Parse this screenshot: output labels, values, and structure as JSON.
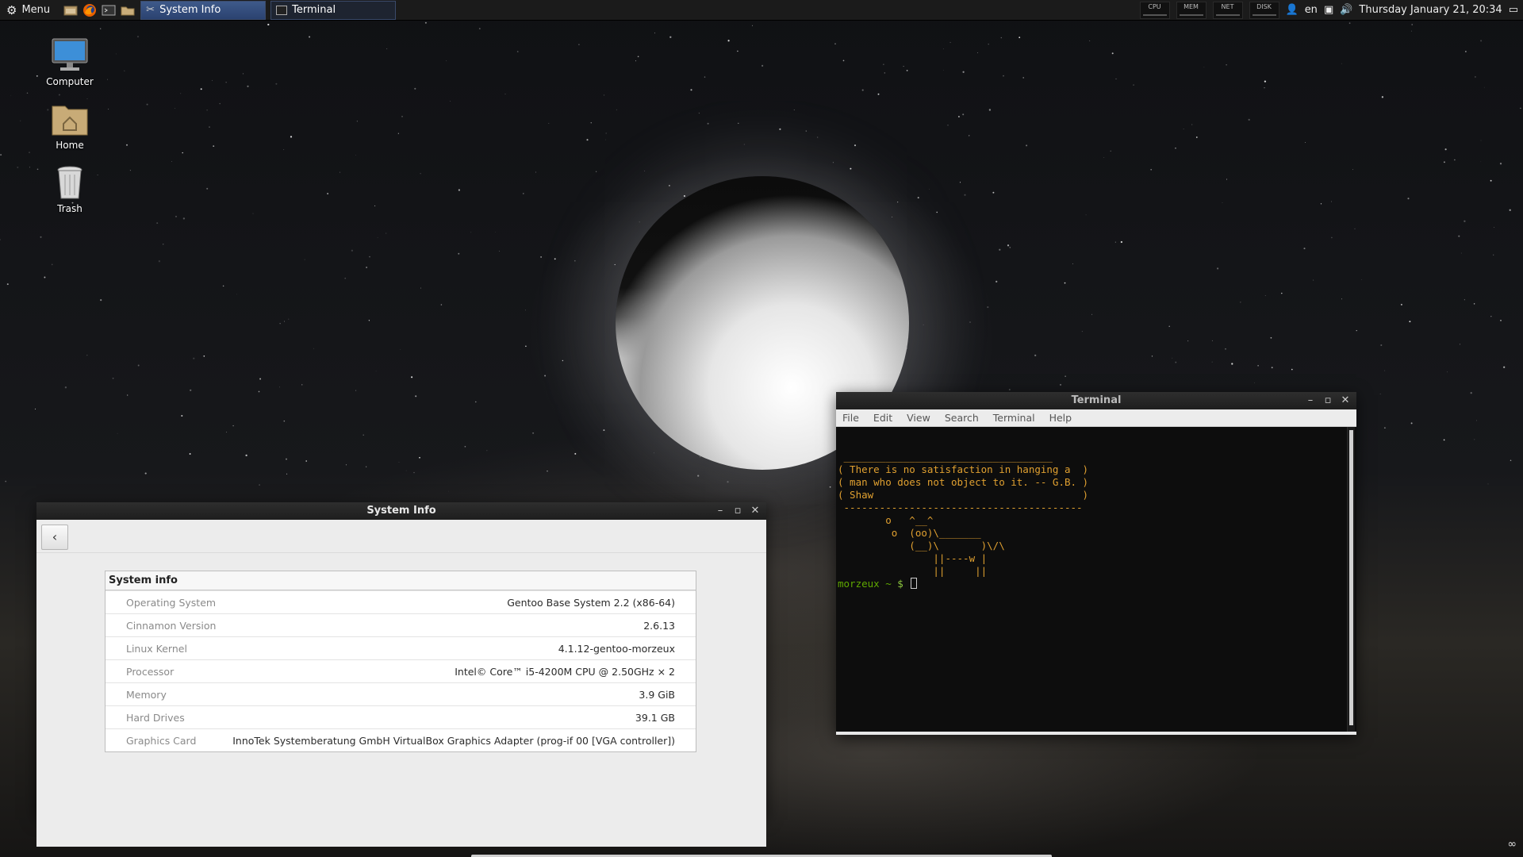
{
  "panel": {
    "menu_label": "Menu",
    "launchers": [
      "files-icon",
      "firefox-icon",
      "terminal-icon",
      "folder-icon"
    ],
    "tasks": [
      {
        "label": "System Info",
        "active": true
      },
      {
        "label": "Terminal",
        "active": false
      }
    ],
    "applets": [
      "CPU",
      "MEM",
      "NET",
      "DISK"
    ],
    "keyboard_layout": "en",
    "clock": "Thursday January 21, 20:34"
  },
  "desktop": {
    "icons": [
      {
        "label": "Computer",
        "icon": "computer-icon"
      },
      {
        "label": "Home",
        "icon": "home-folder-icon"
      },
      {
        "label": "Trash",
        "icon": "trash-icon"
      }
    ]
  },
  "system_info_window": {
    "title": "System Info",
    "back_glyph": "‹",
    "table_header": "System info",
    "rows": [
      {
        "key": "Operating System",
        "value": "Gentoo Base System 2.2 (x86-64)"
      },
      {
        "key": "Cinnamon Version",
        "value": "2.6.13"
      },
      {
        "key": "Linux Kernel",
        "value": "4.1.12-gentoo-morzeux"
      },
      {
        "key": "Processor",
        "value": "Intel© Core™ i5-4200M CPU @ 2.50GHz × 2"
      },
      {
        "key": "Memory",
        "value": "3.9 GiB"
      },
      {
        "key": "Hard Drives",
        "value": "39.1 GB"
      },
      {
        "key": "Graphics Card",
        "value": "InnoTek Systemberatung GmbH VirtualBox Graphics Adapter (prog-if 00 [VGA controller])"
      }
    ]
  },
  "terminal_window": {
    "title": "Terminal",
    "menu": [
      "File",
      "Edit",
      "View",
      "Search",
      "Terminal",
      "Help"
    ],
    "output_lines": [
      " ___________________________________",
      "( There is no satisfaction in hanging a  )",
      "( man who does not object to it. -- G.B. )",
      "( Shaw                                   )",
      " ----------------------------------------",
      "        o   ^__^",
      "         o  (oo)\\_______",
      "            (__)\\       )\\/\\",
      "                ||----w |",
      "                ||     ||"
    ],
    "prompt_user": "morzeux",
    "prompt_path": " ~ ",
    "prompt_symbol": "$"
  },
  "colors": {
    "panel_bg": "#1b1b1b",
    "task_active": "#3e5a8a",
    "terminal_fg": "#e0a030",
    "prompt_user": "#5fa800"
  }
}
